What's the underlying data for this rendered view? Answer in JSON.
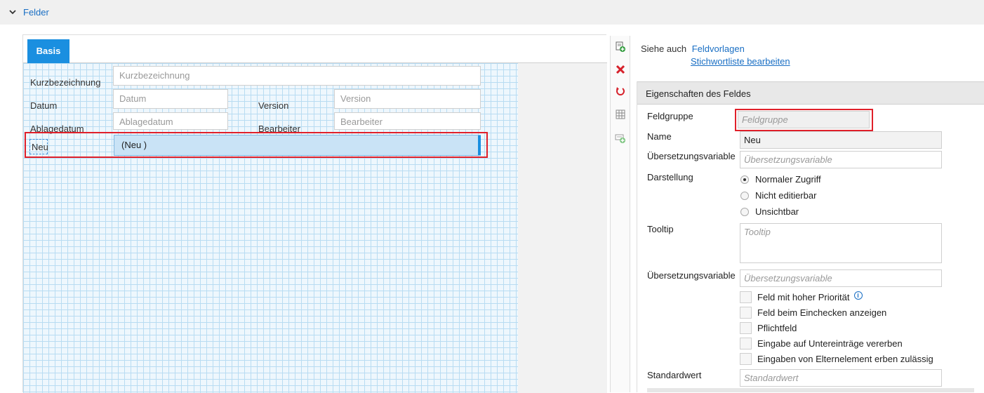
{
  "section": {
    "title": "Felder"
  },
  "designer": {
    "tabs": [
      {
        "label": "Basis",
        "active": true
      }
    ],
    "fields": {
      "kurzbezeichnung": {
        "label": "Kurzbezeichnung",
        "placeholder": "Kurzbezeichnung"
      },
      "datum": {
        "label": "Datum",
        "placeholder": "Datum"
      },
      "version": {
        "label": "Version",
        "placeholder": "Version"
      },
      "ablagedatum": {
        "label": "Ablagedatum",
        "placeholder": "Ablagedatum"
      },
      "bearbeiter": {
        "label": "Bearbeiter",
        "placeholder": "Bearbeiter"
      },
      "neu": {
        "label": "Neu",
        "value": "(Neu )"
      }
    }
  },
  "toolbar": {
    "buttons": [
      {
        "icon": "add-field-icon"
      },
      {
        "icon": "delete-icon"
      },
      {
        "icon": "reset-icon"
      },
      {
        "icon": "grid-icon"
      },
      {
        "icon": "add-row-icon"
      }
    ]
  },
  "see_also": {
    "label": "Siehe auch",
    "link1": "Feldvorlagen",
    "link2": "Stichwortliste bearbeiten"
  },
  "properties": {
    "header": "Eigenschaften des Feldes",
    "feldgruppe": {
      "label": "Feldgruppe",
      "placeholder": "Feldgruppe"
    },
    "name": {
      "label": "Name",
      "value": "Neu"
    },
    "uebersetzung1": {
      "label": "Übersetzungsvariable",
      "placeholder": "Übersetzungsvariable"
    },
    "darstellung": {
      "label": "Darstellung",
      "options": [
        "Normaler Zugriff",
        "Nicht editierbar",
        "Unsichtbar"
      ],
      "selected": "Normaler Zugriff"
    },
    "tooltip": {
      "label": "Tooltip",
      "placeholder": "Tooltip"
    },
    "uebersetzung2": {
      "label": "Übersetzungsvariable",
      "placeholder": "Übersetzungsvariable"
    },
    "checkboxes": [
      "Feld mit hoher Priorität",
      "Feld beim Einchecken anzeigen",
      "Pflichtfeld",
      "Eingabe auf Untereinträge vererben",
      "Eingaben von Elternelement erben zulässig"
    ],
    "standardwert": {
      "label": "Standardwert",
      "placeholder": "Standardwert"
    }
  },
  "colors": {
    "accent": "#1a8fe0",
    "link": "#1a6fc4",
    "highlight": "#e0202a"
  }
}
